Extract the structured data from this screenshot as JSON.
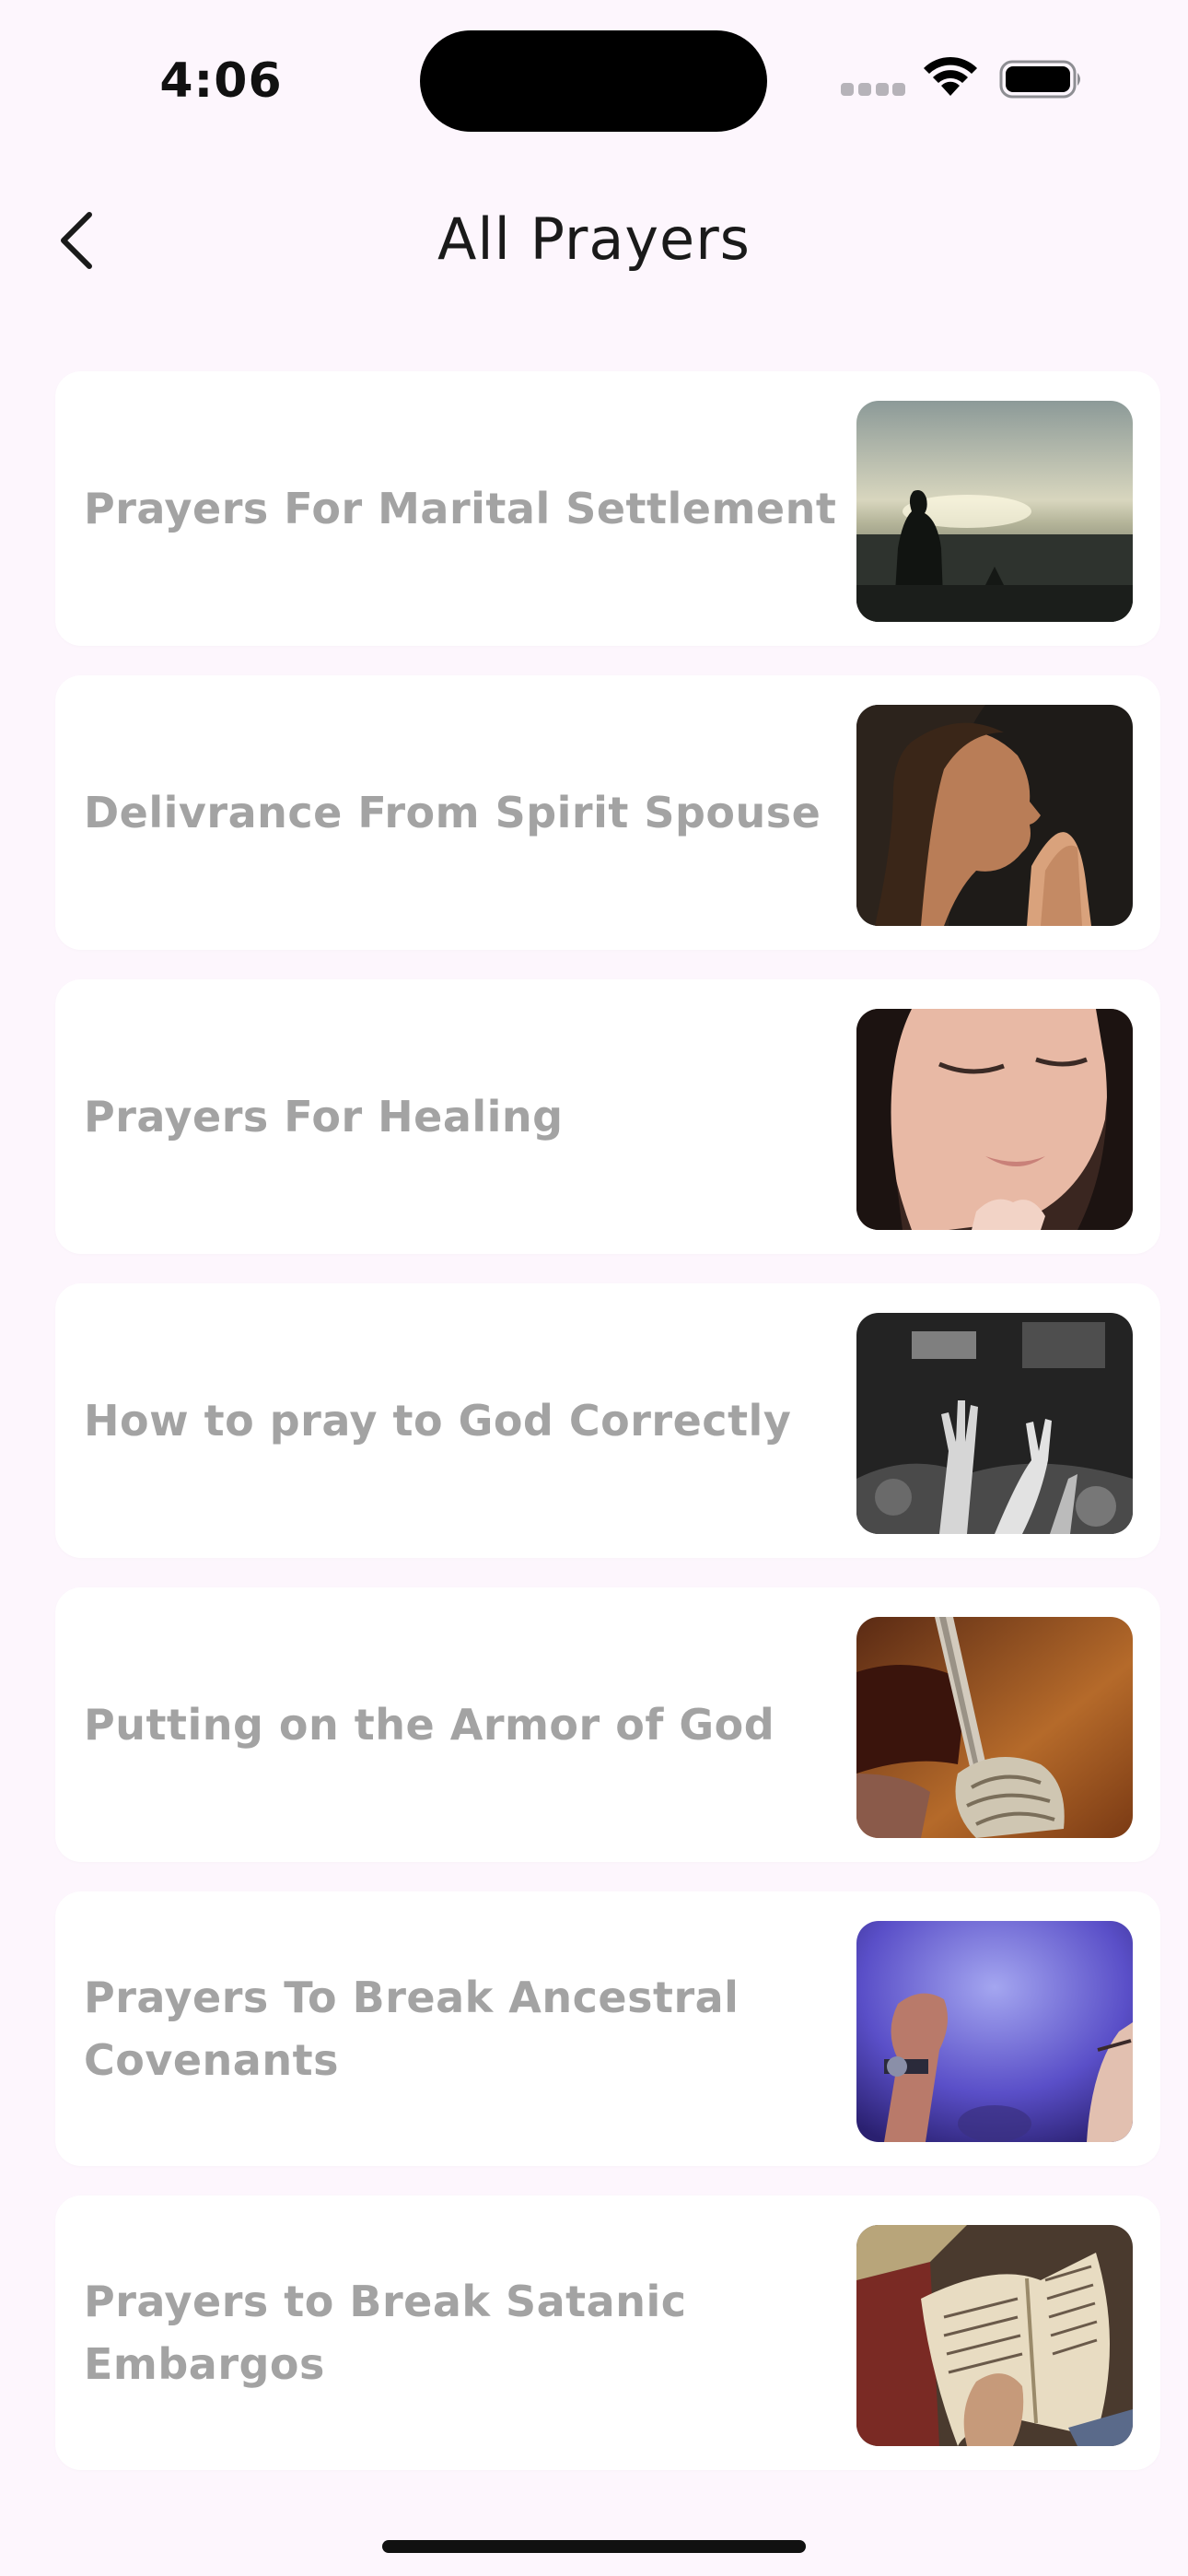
{
  "status_bar": {
    "time": "4:06"
  },
  "header": {
    "title": "All Prayers",
    "back_icon": "chevron-left-icon"
  },
  "prayers": [
    {
      "title": "Prayers For Marital Settlement",
      "image": "praying-silhouette-sunset"
    },
    {
      "title": "Delivrance From Spirit Spouse",
      "image": "woman-praying-hands"
    },
    {
      "title": "Prayers For Healing",
      "image": "girl-eyes-closed-praying"
    },
    {
      "title": "How to pray to God Correctly",
      "image": "raised-hands-worship-bw"
    },
    {
      "title": "Putting on the Armor of God",
      "image": "armor-gauntlet-sword"
    },
    {
      "title": "Prayers To Break Ancestral Covenants",
      "image": "raised-fist-blue-stage"
    },
    {
      "title": "Prayers to Break Satanic Embargos",
      "image": "reading-bible"
    }
  ],
  "colors": {
    "background": "#FDF6FD",
    "card": "#FFFFFF",
    "title_text": "#A3A3A3"
  }
}
